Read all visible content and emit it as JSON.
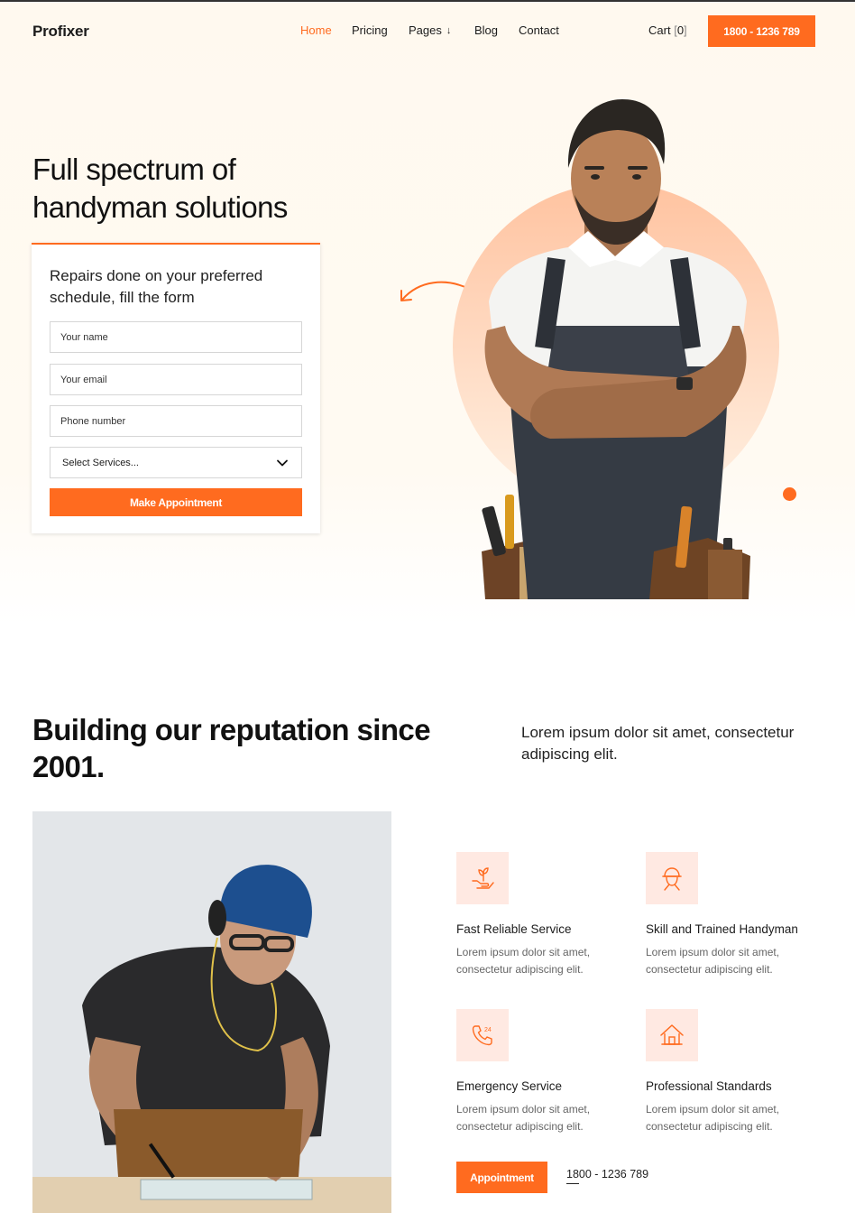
{
  "header": {
    "logo": "Profixer",
    "nav": {
      "home": "Home",
      "pricing": "Pricing",
      "pages": "Pages",
      "blog": "Blog",
      "contact": "Contact"
    },
    "cart_label": "Cart",
    "cart_count": "0",
    "phone": "1800 - 1236 789"
  },
  "hero": {
    "title": "Full spectrum of handyman solutions",
    "form": {
      "heading": "Repairs done on your preferred schedule, fill the form",
      "name_placeholder": "Your name",
      "email_placeholder": "Your email",
      "phone_placeholder": "Phone number",
      "select_value": "Select Services...",
      "submit_label": "Make Appointment"
    }
  },
  "about": {
    "title": "Building our reputation since 2001.",
    "lead": "Lorem ipsum dolor sit amet, consectetur adipiscing elit.",
    "features": [
      {
        "icon": "plant-hand-icon",
        "title": "Fast Reliable Service",
        "text": "Lorem ipsum dolor sit amet, consectetur adipiscing elit."
      },
      {
        "icon": "worker-helmet-icon",
        "title": "Skill and Trained Handyman",
        "text": "Lorem ipsum dolor sit amet, consectetur adipiscing elit."
      },
      {
        "icon": "phone-24-icon",
        "title": "Emergency Service",
        "text": "Lorem ipsum dolor sit amet, consectetur adipiscing elit."
      },
      {
        "icon": "house-icon",
        "title": "Professional Standards",
        "text": "Lorem ipsum dolor sit amet, consectetur adipiscing elit."
      }
    ],
    "cta_label": "Appointment",
    "phone": "1800 - 1236 789"
  },
  "colors": {
    "accent": "#ff6b1f",
    "icon_bg": "#ffe9e2",
    "hero_bg": "#fff9ef"
  }
}
